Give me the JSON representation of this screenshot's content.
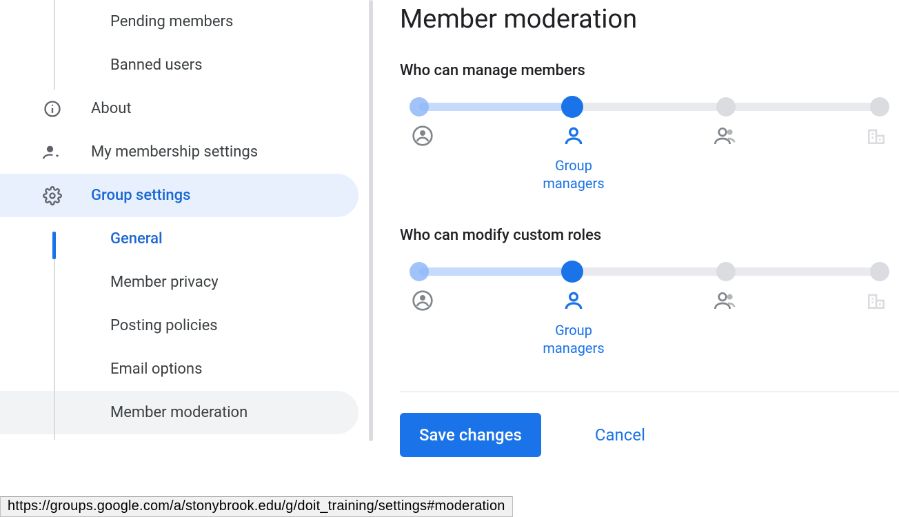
{
  "sidebar": {
    "items": [
      {
        "label": "Pending members"
      },
      {
        "label": "Banned users"
      },
      {
        "label": "About"
      },
      {
        "label": "My membership settings"
      },
      {
        "label": "Group settings"
      }
    ],
    "subitems": [
      {
        "label": "General"
      },
      {
        "label": "Member privacy"
      },
      {
        "label": "Posting policies"
      },
      {
        "label": "Email options"
      },
      {
        "label": "Member moderation"
      }
    ]
  },
  "main": {
    "title": "Member moderation",
    "sections": [
      {
        "label": "Who can manage members",
        "selected": "Group managers"
      },
      {
        "label": "Who can modify custom roles",
        "selected": "Group managers"
      }
    ],
    "stop_labels": {
      "owners": "Group owners",
      "managers": "Group managers",
      "members": "Group members",
      "org": "Entire organization"
    },
    "save": "Save changes",
    "cancel": "Cancel"
  },
  "status_url": "https://groups.google.com/a/stonybrook.edu/g/doit_training/settings#moderation"
}
